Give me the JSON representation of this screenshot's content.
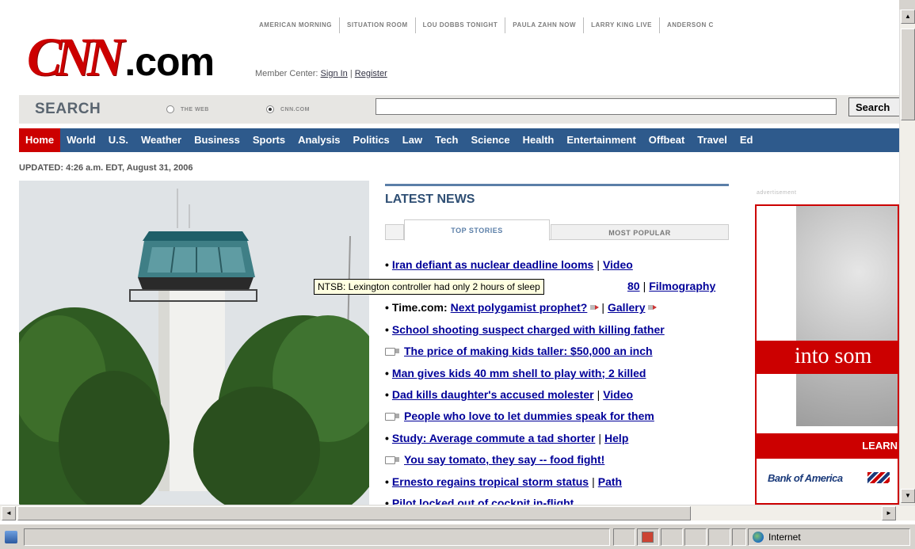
{
  "shows": [
    "AMERICAN MORNING",
    "SITUATION ROOM",
    "LOU DOBBS TONIGHT",
    "PAULA ZAHN NOW",
    "LARRY KING LIVE",
    "ANDERSON C"
  ],
  "logo": {
    "cnn": "CNN",
    "dotcom": ".com"
  },
  "member": {
    "label": "Member Center:",
    "sign_in": "Sign In",
    "sep": " | ",
    "register": "Register"
  },
  "search": {
    "label": "SEARCH",
    "option_web": "THE WEB",
    "option_cnn": "CNN.COM",
    "selected": "CNN.COM",
    "value": "",
    "button": "Search"
  },
  "nav": [
    "Home",
    "World",
    "U.S.",
    "Weather",
    "Business",
    "Sports",
    "Analysis",
    "Politics",
    "Law",
    "Tech",
    "Science",
    "Health",
    "Entertainment",
    "Offbeat",
    "Travel",
    "Ed"
  ],
  "nav_active": "Home",
  "updated": "UPDATED: 4:26 a.m. EDT, August 31, 2006",
  "latest": {
    "title": "LATEST NEWS",
    "tab_top": "TOP STORIES",
    "tab_popular": "MOST POPULAR"
  },
  "stories": [
    {
      "link": "Iran defiant as nuclear deadline looms",
      "extra": "Video"
    },
    {
      "link": "80",
      "extra": "Filmography"
    },
    {
      "prefix": "Time.com:",
      "link": "Next polygamist prophet?",
      "extra": "Gallery"
    },
    {
      "link": "School shooting suspect charged with killing father"
    },
    {
      "link": "The price of making kids taller: $50,000 an inch"
    },
    {
      "link": "Man gives kids 40 mm shell to play with; 2 killed"
    },
    {
      "link": "Dad kills daughter's accused molester",
      "extra": "Video"
    },
    {
      "link": "People who love to let dummies speak for them"
    },
    {
      "link": "Study: Average commute a tad shorter",
      "extra": "Help"
    },
    {
      "link": "You say tomato, they say -- food fight!"
    },
    {
      "link": "Ernesto regains tropical storm status",
      "extra": "Path"
    },
    {
      "link": "Pilot locked out of cockpit in-flight"
    }
  ],
  "tooltip": "NTSB: Lexington controller had only 2 hours of sleep",
  "ad": {
    "label": "advertisement",
    "banner": "into som",
    "learn": "LEARN",
    "bank": "Bank of America"
  },
  "statusbar": {
    "zone": "Internet"
  },
  "colors": {
    "cnn_red": "#cc0000",
    "nav_blue": "#2e5a8c",
    "link_blue": "#000099"
  }
}
